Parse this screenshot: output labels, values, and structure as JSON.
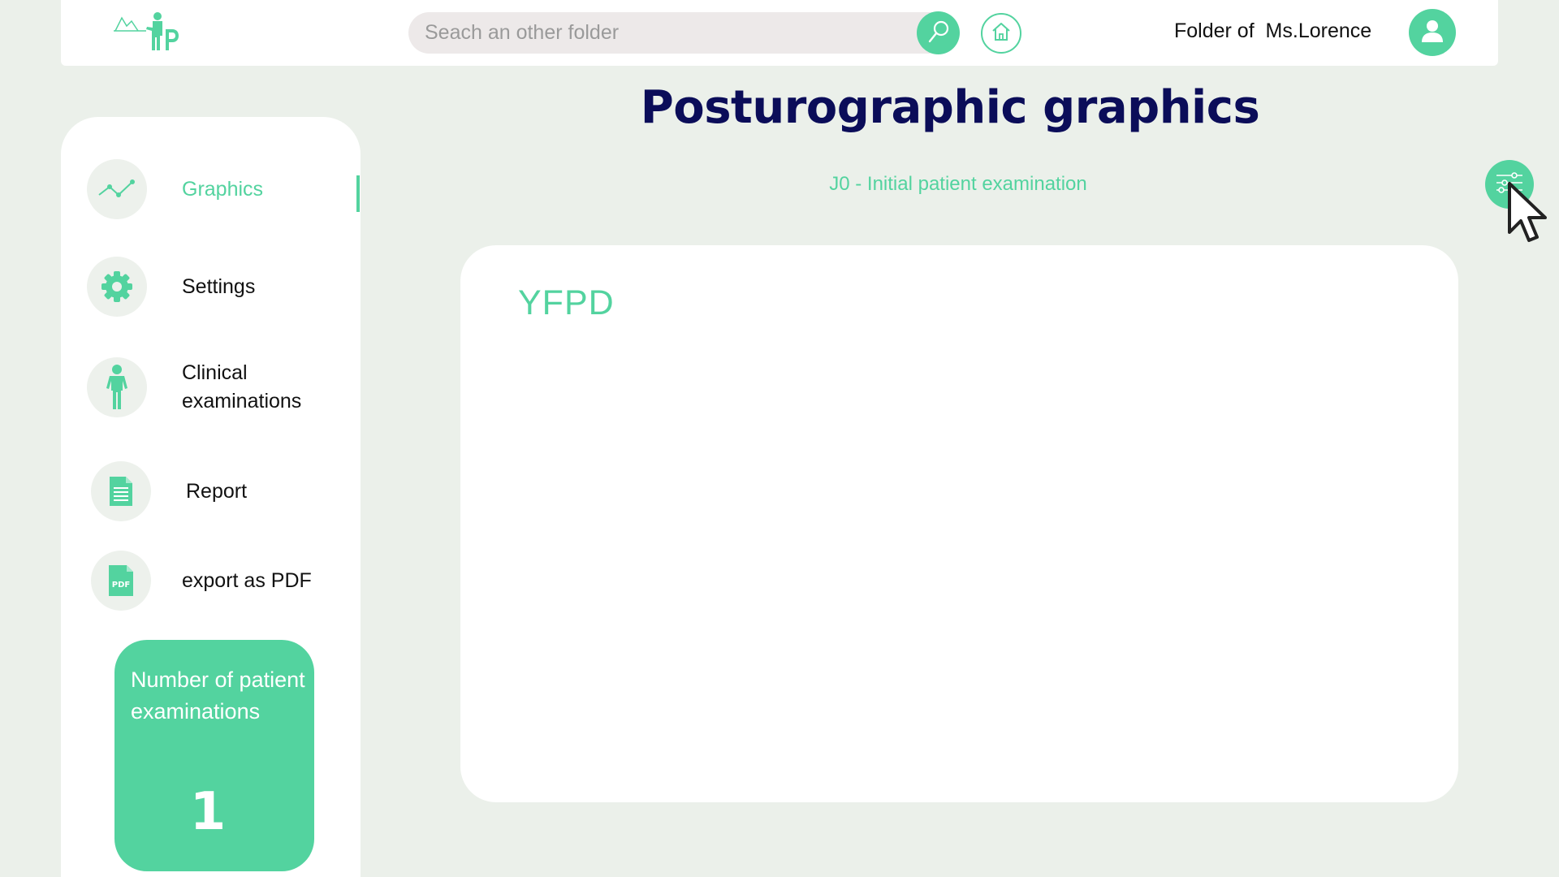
{
  "header": {
    "search": {
      "placeholder": "Seach an other folder",
      "value": ""
    },
    "folder_label": "Folder of  Ms.Lorence"
  },
  "sidebar": {
    "items": [
      {
        "label": "Graphics",
        "icon": "line-chart-icon",
        "active": true
      },
      {
        "label": "Settings",
        "icon": "gear-icon",
        "active": false
      },
      {
        "label": "Clinical examinations",
        "icon": "standing-person-icon",
        "active": false
      },
      {
        "label": "Report",
        "icon": "document-icon",
        "active": false
      },
      {
        "label": "export as PDF",
        "icon": "pdf-file-icon",
        "active": false
      }
    ],
    "exam_count": {
      "label": "Number of patient examinations",
      "value": "1"
    },
    "pdf_badge": "PDF"
  },
  "main": {
    "title": "Posturographic graphics",
    "subtitle": "J0 - Initial patient examination",
    "panel_title": "YFPD"
  },
  "colors": {
    "accent": "#53d39f",
    "title": "#0b0d59",
    "background": "#ebf0ea"
  }
}
